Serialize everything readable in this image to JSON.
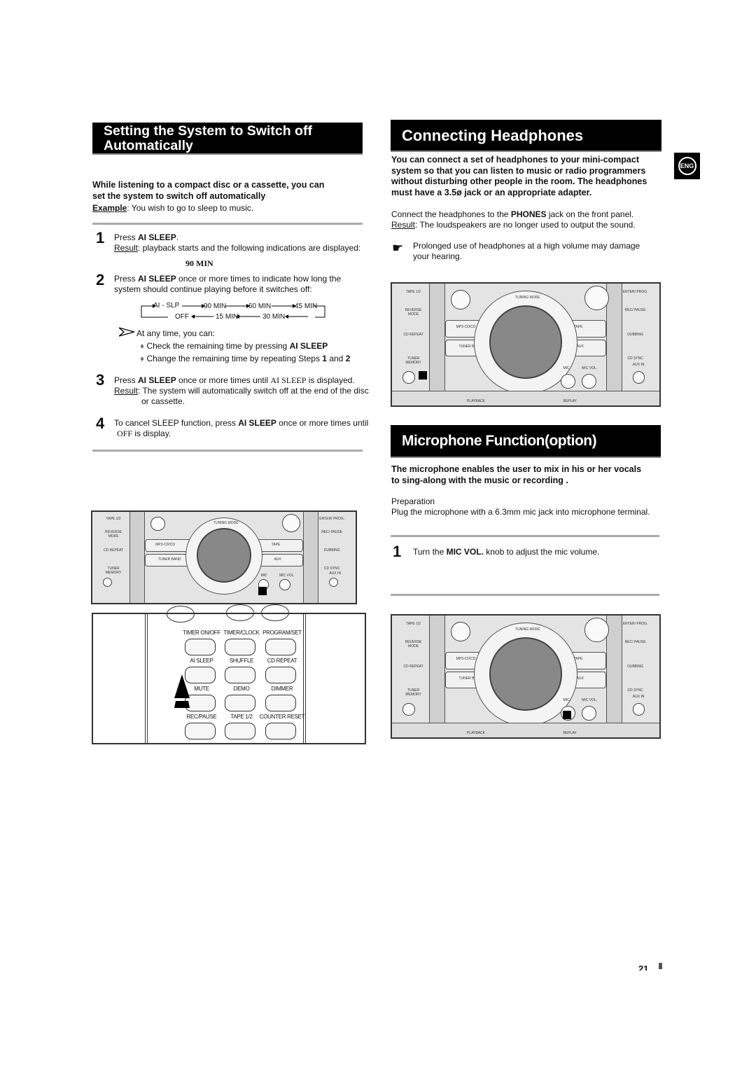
{
  "left": {
    "title_line1": "Setting the System to Switch off",
    "title_line2": "Automatically",
    "intro_line1": "While listening to a compact disc or a cassette, you can",
    "intro_line2": "set the system to switch off automatically",
    "example_label": "Example",
    "example_text": ": You wish to go to sleep to music.",
    "steps": [
      {
        "num": "1",
        "pre": "Press ",
        "bold": "AI SLEEP",
        "post": ".",
        "result_label": "Result",
        "result_text": ": playback starts and the following indications are displayed:",
        "display": "90 MIN"
      },
      {
        "num": "2",
        "pre": "Press ",
        "bold": "AI SLEEP",
        "post": " once or more times to indicate how long the",
        "line2": "system should continue playing before it switches off:"
      },
      {
        "num": "3",
        "pre": "Press ",
        "bold": "AI SLEEP",
        "post": " once or more times until ",
        "disp": "AI SLEEP",
        "post2": " is displayed.",
        "result_label": "Result",
        "result_text": ": The system will automatically switch off at the end of the disc",
        "result_line2": "or cassette."
      },
      {
        "num": "4",
        "pre": "To cancel SLEEP function, press ",
        "bold": "AI SLEEP",
        "post": " once or more times until",
        "disp": "OFF",
        "post2": " is display."
      }
    ],
    "cycle": {
      "top": [
        "AI - SLP",
        "90 MIN",
        "60 MIN",
        "45 MIN"
      ],
      "bottom": [
        "OFF",
        "15 MIN",
        "30 MIN"
      ]
    },
    "tip": "At any time, you can:",
    "bullets": [
      {
        "text": "Check the remaining time by pressing ",
        "bold": "AI SLEEP"
      },
      {
        "text": "Change the remaining time by repeating Steps ",
        "bold": "1",
        "mid": " and ",
        "bold2": "2"
      }
    ],
    "remote": {
      "buttons": [
        "TIMER ON/OFF",
        "TIMER/CLOCK",
        "PROGRAM/SET",
        "AI SLEEP",
        "SHUFFLE",
        "CD REPEAT",
        "MUTE",
        "DEMO",
        "DIMMER",
        "REC/PAUSE",
        "TAPE 1/2",
        "COUNTER RESET"
      ]
    }
  },
  "right": {
    "title": "Connecting Headphones",
    "intro": [
      "You can connect a set of headphones to your mini-compact",
      "system so that you can listen to music or radio programmers",
      "without disturbing other people in the room. The headphones",
      "must have a 3.5ø jack or an appropriate adapter."
    ],
    "connect_pre": "Connect the headphones to the ",
    "connect_bold": "PHONES",
    "connect_post": " jack on the front panel.",
    "result_label": "Result",
    "result_text": ": The loudspeakers are no longer used to output the sound.",
    "note_line1": "Prolonged use of headphones at a high volume may damage",
    "note_line2": "your hearing.",
    "mic_title": "Microphone Function(option)",
    "mic_intro": [
      "The microphone enables the user to mix in his or her vocals",
      "to sing-along with the music or recording ."
    ],
    "prep_label": "Preparation",
    "prep_text": "Plug the microphone with a 6.3mm mic jack into microphone terminal.",
    "mic_step": {
      "num": "1",
      "pre": "Turn the ",
      "bold": "MIC VOL.",
      "post": " knob to adjust the mic volume."
    }
  },
  "panel_labels": {
    "tape12": "TAPE 1/2",
    "reverse": "REVERSE MODE",
    "cdrepeat": "CD REPEAT",
    "tunermem": "TUNER MEMORY",
    "mp3": "MP3-CD/CD",
    "tuner": "TUNER BAND",
    "tape": "TAPE",
    "aux": "AUX",
    "enter": "ENTER/ PROG.",
    "recpause": "REC/ PAUSE",
    "dubbing": "DUBBING",
    "cdsync": "CD SYNC",
    "tuning": "TUNING MODE",
    "mic": "MIC",
    "micvol": "MIC VOL.",
    "auxin": "AUX IN",
    "playback": "PLAYBACK",
    "replay": "REPLAY"
  },
  "badge": "ENG",
  "page_number": "21"
}
